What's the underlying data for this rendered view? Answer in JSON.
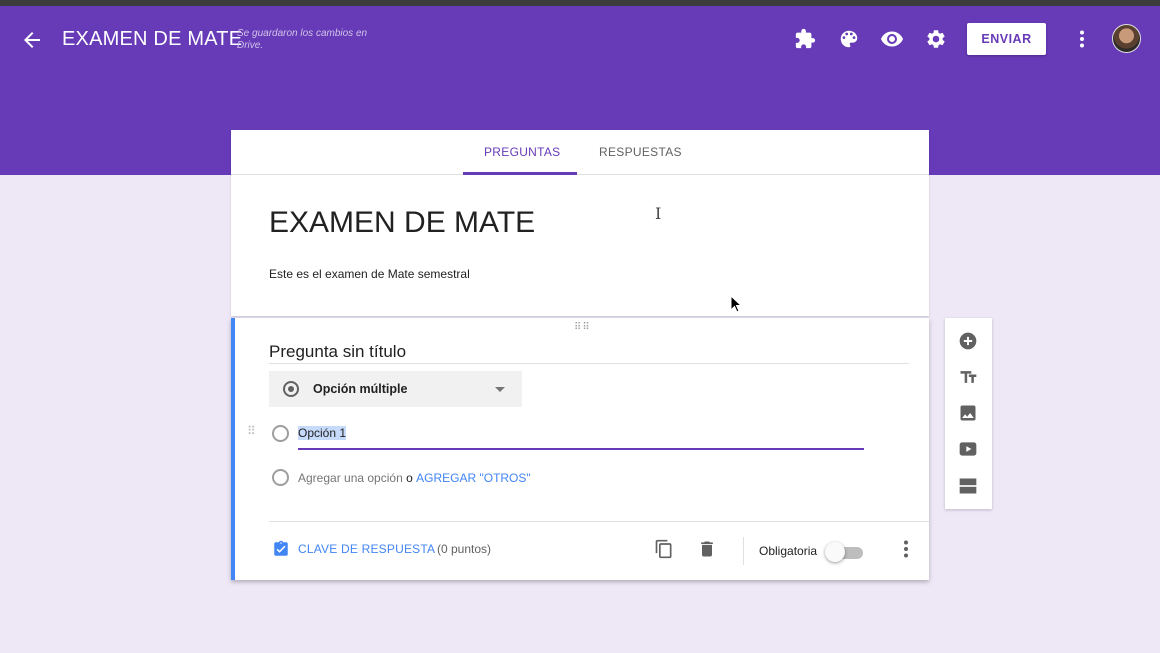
{
  "header": {
    "title": "EXAMEN DE MATE",
    "saved_status": "Se guardaron los cambios en Drive.",
    "send_label": "ENVIAR",
    "icons": [
      "back-arrow-icon",
      "puzzle-icon",
      "palette-icon",
      "eye-icon",
      "gear-icon",
      "more-vert-icon"
    ]
  },
  "tabs": [
    {
      "label": "PREGUNTAS",
      "active": true
    },
    {
      "label": "RESPUESTAS",
      "active": false
    }
  ],
  "form": {
    "title": "EXAMEN DE MATE",
    "description": "Este es el examen de Mate semestral"
  },
  "question": {
    "title": "Pregunta sin título",
    "type": "Opción múltiple",
    "options": [
      "Opción 1"
    ],
    "add_option": "Agregar una opción",
    "add_or": "o",
    "add_other": "AGREGAR \"OTROS\"",
    "answer_key_label": "CLAVE DE RESPUESTA",
    "points": "(0 puntos)",
    "required_label": "Obligatoria",
    "required": false
  },
  "side_toolbar": [
    "add-question-icon",
    "title-text-icon",
    "image-icon",
    "video-icon",
    "section-icon"
  ],
  "colors": {
    "primary": "#673ab7",
    "background": "#ede7f6",
    "accent_blue": "#4285f4"
  }
}
